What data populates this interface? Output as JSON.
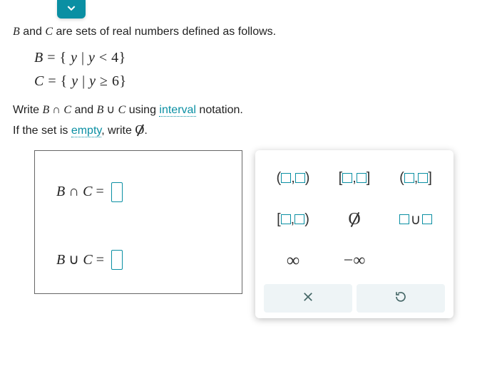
{
  "header": {
    "chevron_icon": "chevron-down"
  },
  "prompt": {
    "intro_html": "B and C are sets of real numbers defined as follows.",
    "set_B": "B = { y | y < 4 }",
    "set_C": "C = { y | y ≥ 6 }",
    "instruction_pre": "Write ",
    "instruction_expr": "B ∩ C and B ∪ C",
    "instruction_post": " using ",
    "link_interval": "interval",
    "instruction_tail": " notation.",
    "empty_pre": "If the set is ",
    "link_empty": "empty",
    "empty_post": ", write ∅."
  },
  "answers": {
    "intersect_label": "B ∩ C =",
    "union_label": "B ∪ C =",
    "intersect_value": "",
    "union_value": ""
  },
  "palette": {
    "open_open": "(▫,▫)",
    "closed_closed": "[▫,▫]",
    "open_closed": "(▫,▫]",
    "closed_open": "[▫,▫)",
    "empty_set": "∅",
    "union_op": "▫∪▫",
    "infinity": "∞",
    "neg_infinity": "−∞",
    "clear": "✕",
    "reset": "↺"
  }
}
